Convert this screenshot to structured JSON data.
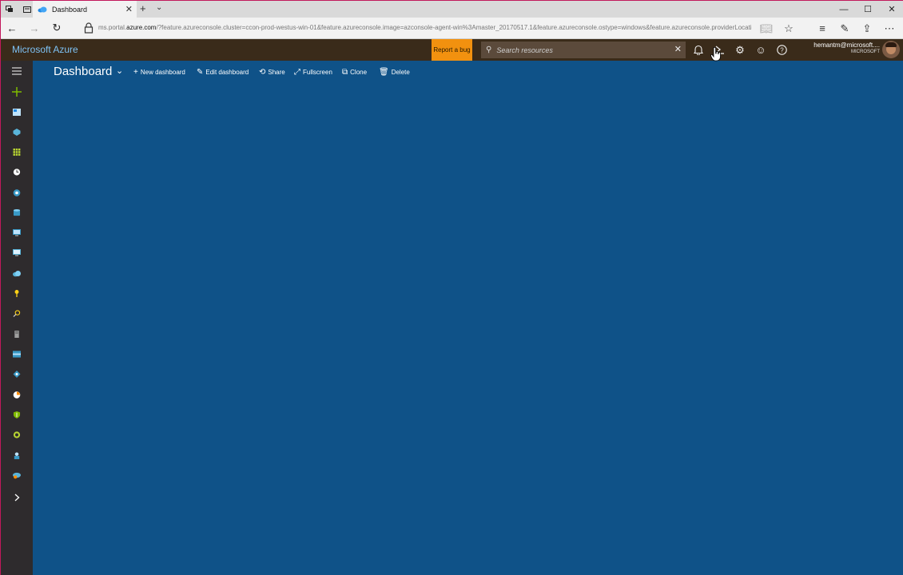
{
  "browser": {
    "tab_title": "Dashboard",
    "url_prefix": "ms.portal.",
    "url_domain": "azure.com",
    "url_rest": "/?feature.azureconsole.cluster=ccon-prod-westus-win-01&feature.azureconsole.image=azconsole-agent-win%3Amaster_20170517.1&feature.azureconsole.ostype=windows&feature.azureconsole.providerLocati"
  },
  "azure": {
    "brand": "Microsoft Azure",
    "report_bug": "Report a bug",
    "search_placeholder": "Search resources",
    "user_name": "hemantm@microsoft....",
    "user_org": "MICROSOFT"
  },
  "dashboard": {
    "title": "Dashboard",
    "commands": [
      {
        "label": "New dashboard",
        "icon": "plus-icon"
      },
      {
        "label": "Edit dashboard",
        "icon": "pencil-icon"
      },
      {
        "label": "Share",
        "icon": "share-icon"
      },
      {
        "label": "Fullscreen",
        "icon": "expand-icon"
      },
      {
        "label": "Clone",
        "icon": "clone-icon"
      },
      {
        "label": "Delete",
        "icon": "trash-icon"
      }
    ]
  },
  "sidebar_icons": [
    "menu-icon",
    "create-resource-icon",
    "dashboard-icon",
    "resource-groups-icon",
    "all-resources-icon",
    "recent-icon",
    "app-services-icon",
    "sql-databases-icon",
    "virtual-machines-icon",
    "virtual-machines-classic-icon",
    "cloud-services-icon",
    "key-vault-icon",
    "subscriptions-icon",
    "storage-icon",
    "storage-accounts-icon",
    "virtual-networks-icon",
    "cost-management-icon",
    "security-center-icon",
    "advisor-icon",
    "help-support-icon",
    "automation-icon",
    "more-services-icon"
  ],
  "colors": {
    "dashboard_bg": "#0f5288",
    "topbar_bg": "#3a2b1a",
    "sidebar_bg": "#2e2b2d",
    "report_bug_bg": "#f2910f",
    "brand_text": "#7ec2f5"
  }
}
